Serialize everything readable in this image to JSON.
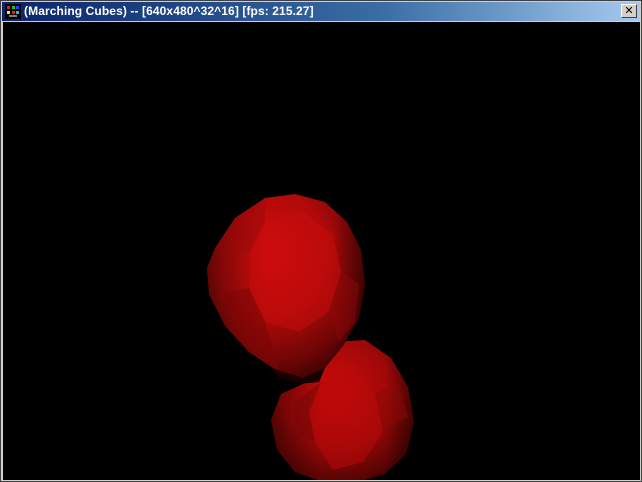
{
  "window": {
    "title": "(Marching Cubes) -- [640x480^32^16] [fps: 215.27]",
    "close_glyph": "✕",
    "icon": "app-icon"
  },
  "scene": {
    "background": "#000000",
    "object": "red-metaballs",
    "blob_color": "#c00000"
  }
}
